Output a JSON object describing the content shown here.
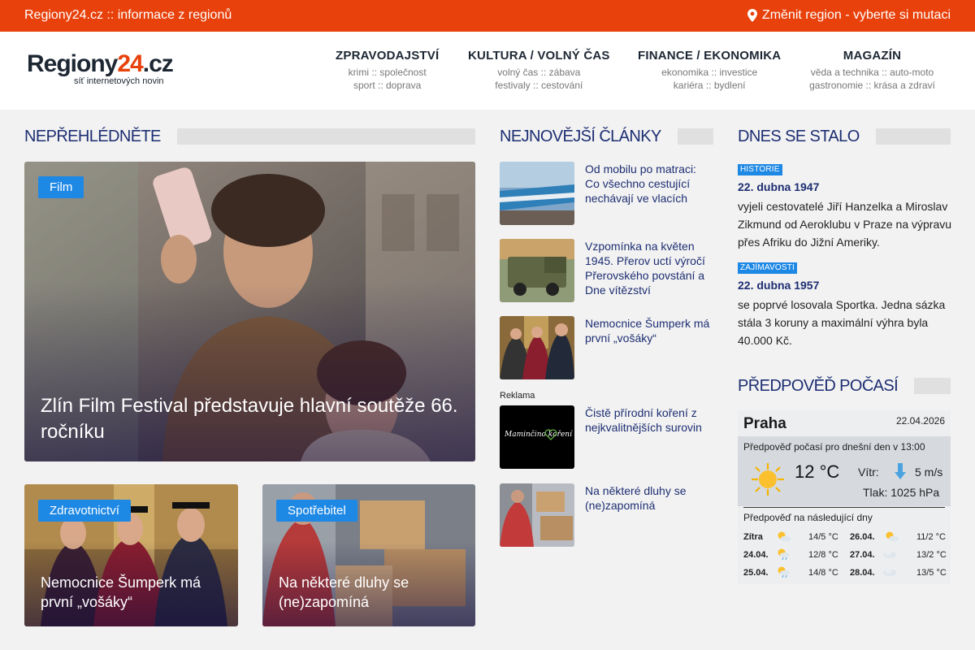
{
  "topbar": {
    "site_text": "Regiony24.cz :: informace z regionů",
    "region_text": "Změnit region - vyberte si mutaci",
    "bg_color": "#e8410b"
  },
  "logo": {
    "brand_a": "Regiony",
    "brand_b": "24",
    "brand_c": ".cz",
    "tagline": "síť internetových novin"
  },
  "nav": [
    {
      "label": "ZPRAVODAJSTVÍ",
      "line1": "krimi :: společnost",
      "line2": "sport :: doprava"
    },
    {
      "label": "KULTURA / VOLNÝ ČAS",
      "line1": "volný čas :: zábava",
      "line2": "festivaly :: cestování"
    },
    {
      "label": "FINANCE / EKONOMIKA",
      "line1": "ekonomika :: investice",
      "line2": "kariéra :: bydlení"
    },
    {
      "label": "MAGAZÍN",
      "line1": "věda a technika :: auto-moto",
      "line2": "gastronomie :: krása a zdraví"
    }
  ],
  "sections": {
    "dont_miss": "NEPŘEHLÉDNĚTE",
    "latest": "NEJNOVĚJŠÍ ČLÁNKY",
    "today": "DNES SE STALO",
    "weather": "PŘEDPOVĚĎ POČASÍ"
  },
  "hero": {
    "badge": "Film",
    "title": "Zlín Film Festival představuje hlavní soutěže 66. ročníku"
  },
  "cards": [
    {
      "badge": "Zdravotnictví",
      "title": "Nemocnice Šumperk má první „vošáky“"
    },
    {
      "badge": "Spotřebitel",
      "title": "Na některé dluhy se (ne)zapomíná"
    }
  ],
  "latest": [
    {
      "title": "Od mobilu po matraci: Co všechno cestující nechávají ve vlacích"
    },
    {
      "title": "Vzpomínka na květen 1945. Přerov uctí výročí Přerovského povstání a Dne vítězství"
    },
    {
      "title": "Nemocnice Šumperk má první „vošáky“"
    },
    {
      "title": "Čistě přírodní koření z nejkvalitnějších surovin"
    },
    {
      "title": "Na některé dluhy se (ne)zapomíná"
    }
  ],
  "ad_label": "Reklama",
  "ad_logo_text": "Maminčino koření",
  "today": [
    {
      "badge": "HISTORIE",
      "date": "22. dubna 1947",
      "text": "vyjeli cestovatelé Jiří Hanzelka a Miroslav Zikmund od Aeroklubu v Praze na výpravu přes Afriku do Jižní Ameriky."
    },
    {
      "badge": "ZAJÍMAVOSTI",
      "date": "22. dubna 1957",
      "text": "se poprvé losovala Sportka. Jedna sázka stála 3 koruny a maximální výhra byla 40.000 Kč."
    }
  ],
  "weather": {
    "city": "Praha",
    "date": "22.04.2026",
    "forecast_label": "Předpověď počasí pro dnešní den v 13:00",
    "temp": "12 °C",
    "wind_label": "Vítr:",
    "wind_value": "5 m/s",
    "pressure_label": "Tlak:",
    "pressure_value": "1025 hPa",
    "next_label": "Předpověď na následující dny",
    "days": [
      {
        "day": "Zítra",
        "temps": "14/5 °C",
        "icon": "sun-cloud-icon"
      },
      {
        "day": "26.04.",
        "temps": "11/2 °C",
        "icon": "sun-cloud-icon"
      },
      {
        "day": "24.04.",
        "temps": "12/8 °C",
        "icon": "sun-rain-icon"
      },
      {
        "day": "27.04.",
        "temps": "13/2 °C",
        "icon": "cloud-icon"
      },
      {
        "day": "25.04.",
        "temps": "14/8 °C",
        "icon": "sun-rain-icon"
      },
      {
        "day": "28.04.",
        "temps": "13/5 °C",
        "icon": "cloud-icon"
      }
    ]
  }
}
